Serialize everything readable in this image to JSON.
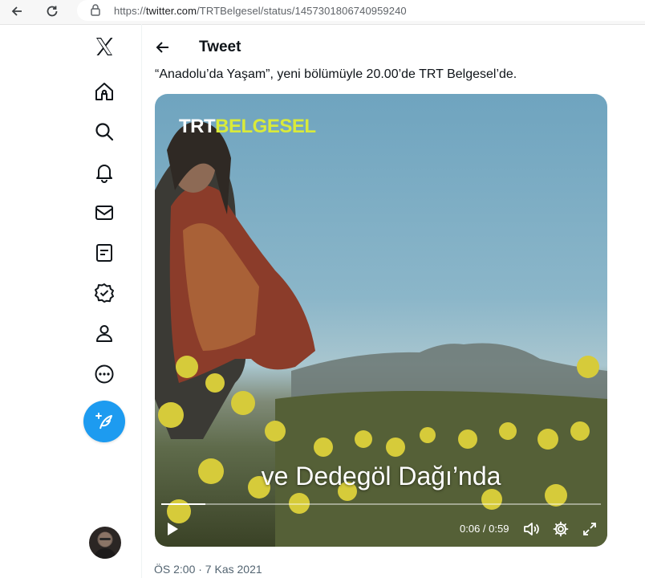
{
  "browser": {
    "url_prefix": "https://",
    "url_host": "twitter.com",
    "url_path": "/TRTBelgesel/status/1457301806740959240"
  },
  "sidebar": {
    "items": [
      {
        "name": "home"
      },
      {
        "name": "explore"
      },
      {
        "name": "notifications"
      },
      {
        "name": "messages"
      },
      {
        "name": "lists"
      },
      {
        "name": "verified"
      },
      {
        "name": "profile"
      },
      {
        "name": "more"
      }
    ]
  },
  "header": {
    "title": "Tweet"
  },
  "tweet": {
    "text": "“Anadolu’da Yaşam”, yeni bölümüyle 20.00’de TRT Belgesel’de.",
    "timestamp": "ÖS 2:00 · 7 Kas 2021"
  },
  "video": {
    "logo_part1": "TRT",
    "logo_part2": "BELGESEL",
    "subtitle": "ve Dedegöl Dağı’nda",
    "time": "0:06 / 0:59",
    "progress": 0.1
  },
  "colors": {
    "accent": "#1d9bf0",
    "logo_yellow": "#d9ea3a"
  }
}
